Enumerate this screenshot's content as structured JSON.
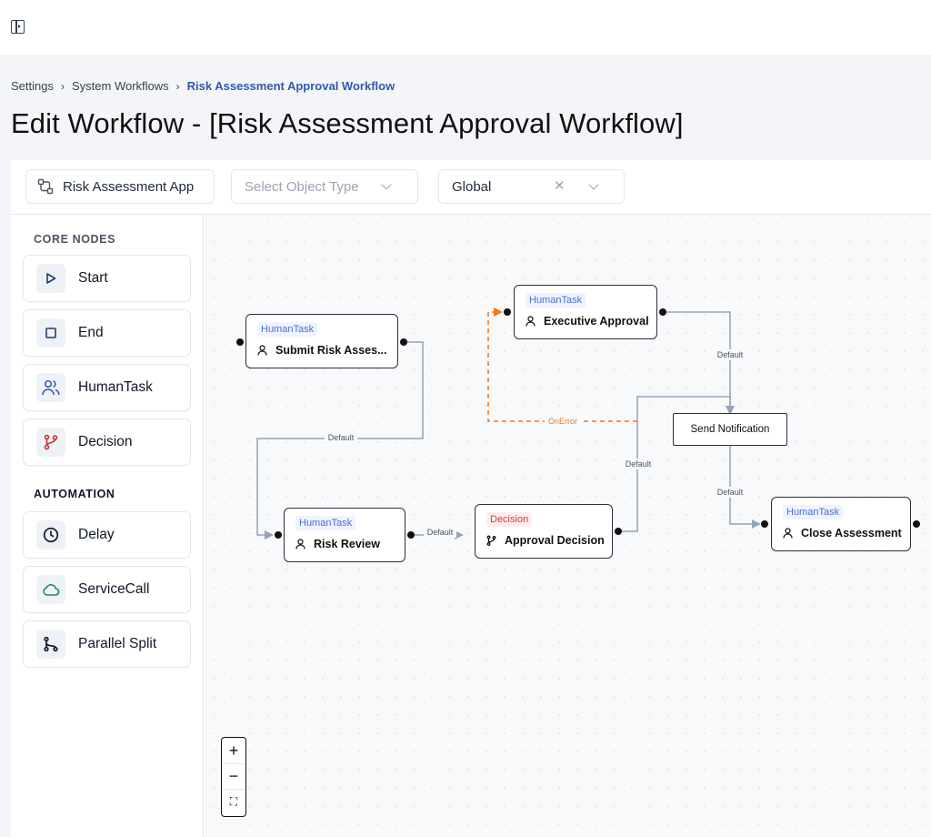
{
  "breadcrumb": {
    "items": [
      "Settings",
      "System Workflows"
    ],
    "current": "Risk Assessment Approval Workflow"
  },
  "page": {
    "title": "Edit Workflow - [Risk Assessment Approval Workflow]"
  },
  "toolbar": {
    "workflow_name": "Risk Assessment App",
    "object_type_placeholder": "Select Object Type",
    "scope": "Global"
  },
  "palette": {
    "core_label": "CORE NODES",
    "core_items": [
      "Start",
      "End",
      "HumanTask",
      "Decision"
    ],
    "automation_label": "AUTOMATION",
    "automation_items": [
      "Delay",
      "ServiceCall",
      "Parallel Split"
    ]
  },
  "nodes": {
    "submit": {
      "tag": "HumanTask",
      "label": "Submit Risk Asses..."
    },
    "executive": {
      "tag": "HumanTask",
      "label": "Executive Approval"
    },
    "send_notification": {
      "label": "Send Notification"
    },
    "risk_review": {
      "tag": "HumanTask",
      "label": "Risk Review"
    },
    "approval_decision": {
      "tag": "Decision",
      "label": "Approval Decision"
    },
    "close": {
      "tag": "HumanTask",
      "label": "Close Assessment"
    }
  },
  "edges": {
    "default_label": "Default",
    "error_label": "OnError"
  },
  "colors": {
    "accent": "#2f5aa8",
    "edge": "#94a3b8",
    "error_edge": "#f07a1a",
    "decision_tag": "#d43a3a",
    "human_tag": "#4a6fd0"
  },
  "zoom": {
    "in": "+",
    "out": "−",
    "fit": "⛶"
  }
}
